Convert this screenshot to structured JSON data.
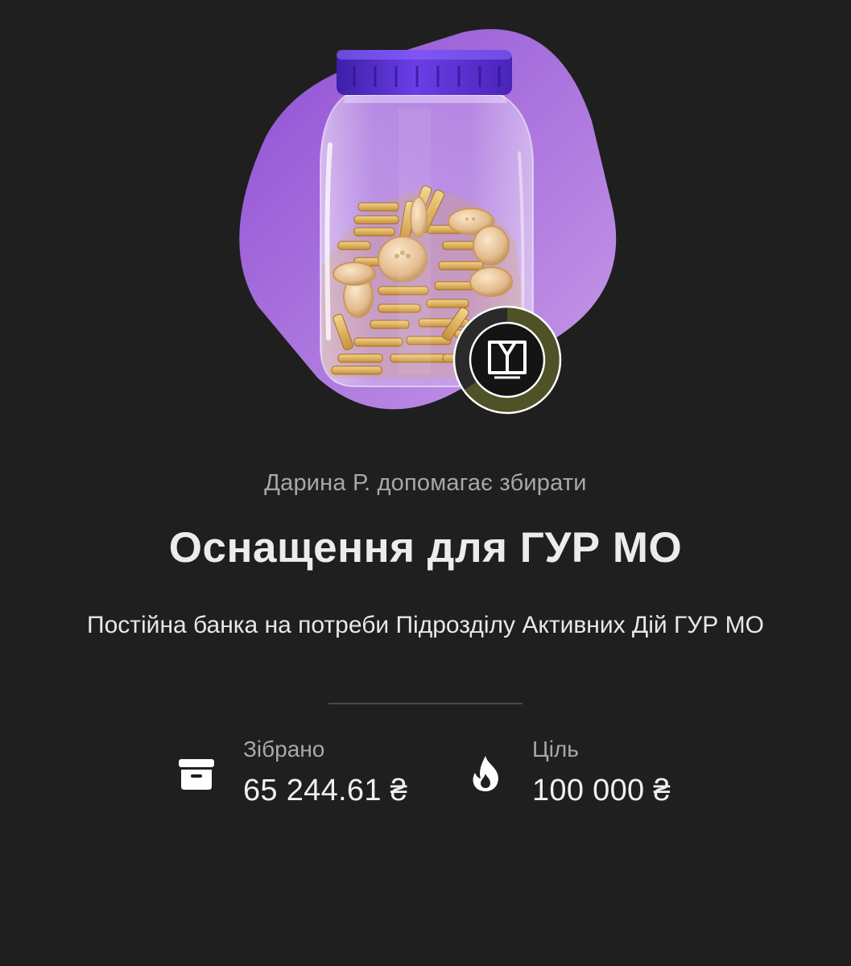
{
  "jar": {
    "helper_text": "Дарина Р. допомагає збирати",
    "title": "Оснащення для ГУР МО",
    "description": "Постійна банка на потреби Підрозділу Активних Дій ГУР МО",
    "collected_label": "Зібрано",
    "collected_value": "65 244.61 ₴",
    "goal_label": "Ціль",
    "goal_value": "100 000 ₴",
    "progress_fraction": 0.652
  },
  "icons": {
    "jar": "jar-with-coins-illustration",
    "badge": "organization-logo-badge",
    "collected": "archive-box-icon",
    "goal": "flame-icon"
  },
  "colors": {
    "background": "#1f1f1f",
    "accent_purple": "#9a62d6",
    "lid_purple": "#5a2fd0",
    "progress_olive": "#4f5226"
  }
}
